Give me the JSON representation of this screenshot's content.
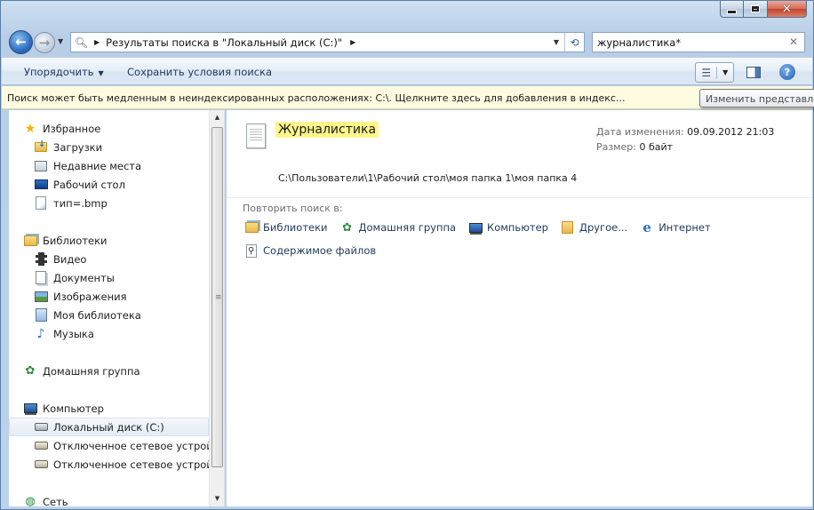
{
  "window": {
    "minimize_glyph": "min",
    "maximize_glyph": "max",
    "close_glyph": "✕"
  },
  "nav": {
    "back_glyph": "←",
    "forward_glyph": "→",
    "address": {
      "text": "Результаты поиска в \"Локальный диск (C:)\"",
      "separator_glyph": "▶",
      "dropdown_glyph": "▼",
      "refresh_glyph": "⟲"
    },
    "search": {
      "value": "журналистика*",
      "clear_glyph": "✕"
    }
  },
  "toolbar": {
    "organize_label": "Упорядочить",
    "organize_caret": "▼",
    "save_search_label": "Сохранить условия поиска",
    "view_glyph": "☰",
    "view_dd_glyph": "▼",
    "help_glyph": "?"
  },
  "infobar": {
    "text": "Поиск может быть медленным в неиндексированных расположениях: C:\\. Щелкните здесь для добавления в индекс..."
  },
  "tooltip": {
    "text": "Изменить представление"
  },
  "sidebar": {
    "favorites": {
      "label": "Избранное",
      "items": [
        {
          "label": "Загрузки",
          "icon": "downloads-folder-icon"
        },
        {
          "label": "Недавние места",
          "icon": "recent-places-icon"
        },
        {
          "label": "Рабочий стол",
          "icon": "desktop-icon"
        },
        {
          "label": "тип=.bmp",
          "icon": "saved-search-icon"
        }
      ]
    },
    "libraries": {
      "label": "Библиотеки",
      "items": [
        {
          "label": "Видео",
          "icon": "video-icon"
        },
        {
          "label": "Документы",
          "icon": "documents-icon"
        },
        {
          "label": "Изображения",
          "icon": "images-icon"
        },
        {
          "label": "Моя библиотека",
          "icon": "library-icon"
        },
        {
          "label": "Музыка",
          "icon": "music-icon"
        }
      ]
    },
    "homegroup": {
      "label": "Домашняя группа"
    },
    "computer": {
      "label": "Компьютер",
      "items": [
        {
          "label": "Локальный диск (C:)",
          "selected": true
        },
        {
          "label": "Отключенное сетевое устройство"
        },
        {
          "label": "Отключенное сетевое устройство"
        }
      ]
    },
    "network": {
      "label": "Сеть"
    }
  },
  "result": {
    "name": "Журналистика",
    "date_label": "Дата изменения:",
    "date_value": "09.09.2012 21:03",
    "size_label": "Размер:",
    "size_value": "0 байт",
    "path": "C:\\Пользователи\\1\\Рабочий стол\\моя папка 1\\моя папка 4"
  },
  "search_again": {
    "label": "Повторить поиск в:",
    "locations": [
      "Библиотеки",
      "Домашняя группа",
      "Компьютер",
      "Другое...",
      "Интернет"
    ],
    "file_contents": "Содержимое файлов"
  },
  "colors": {
    "highlight": "#fff68c",
    "infobar": "#fffbe0",
    "link_text": "#1e395b"
  }
}
